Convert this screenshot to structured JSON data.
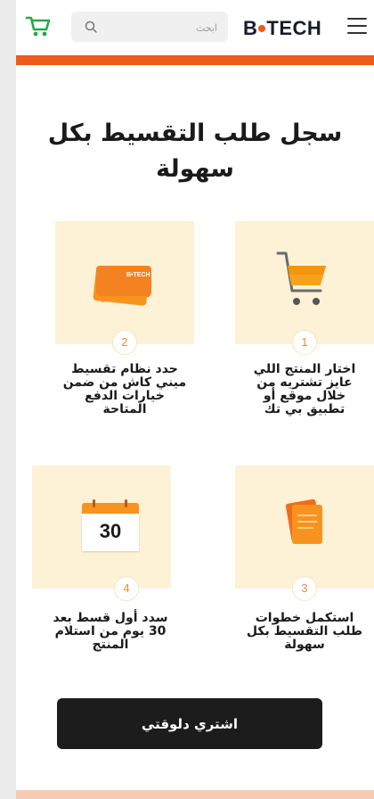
{
  "header": {
    "search_placeholder": "ابحث",
    "logo_part1": "B",
    "logo_part2": "TECH",
    "cart_icon": "cart-icon",
    "menu_icon": "hamburger-menu-icon",
    "search_icon": "search-icon"
  },
  "main": {
    "title": "سجل طلب التقسيط بكل سهولة",
    "steps": [
      {
        "number": "1",
        "text": "اختار المنتج اللي عايز تشتريه من خلال موقع أو تطبيق بي تك",
        "icon": "shopping-cart-icon"
      },
      {
        "number": "2",
        "text": "حدد نظام تقسيط ميني كاش من ضمن خيارات الدفع المتاحة",
        "icon": "card-icon",
        "card_label": "B•TECH"
      },
      {
        "number": "3",
        "text": "استكمل خطوات طلب التقسيط بكل سهولة",
        "icon": "documents-icon"
      },
      {
        "number": "4",
        "text": "سدد أول قسط بعد 30 يوم من استلام المنتج",
        "icon": "calendar-icon",
        "calendar_day": "30"
      }
    ],
    "cta_label": "اشتري دلوقتي"
  },
  "colors": {
    "brand_orange": "#f05a1a",
    "card_bg": "#fdf1d6",
    "button_bg": "#1c1c1c"
  }
}
